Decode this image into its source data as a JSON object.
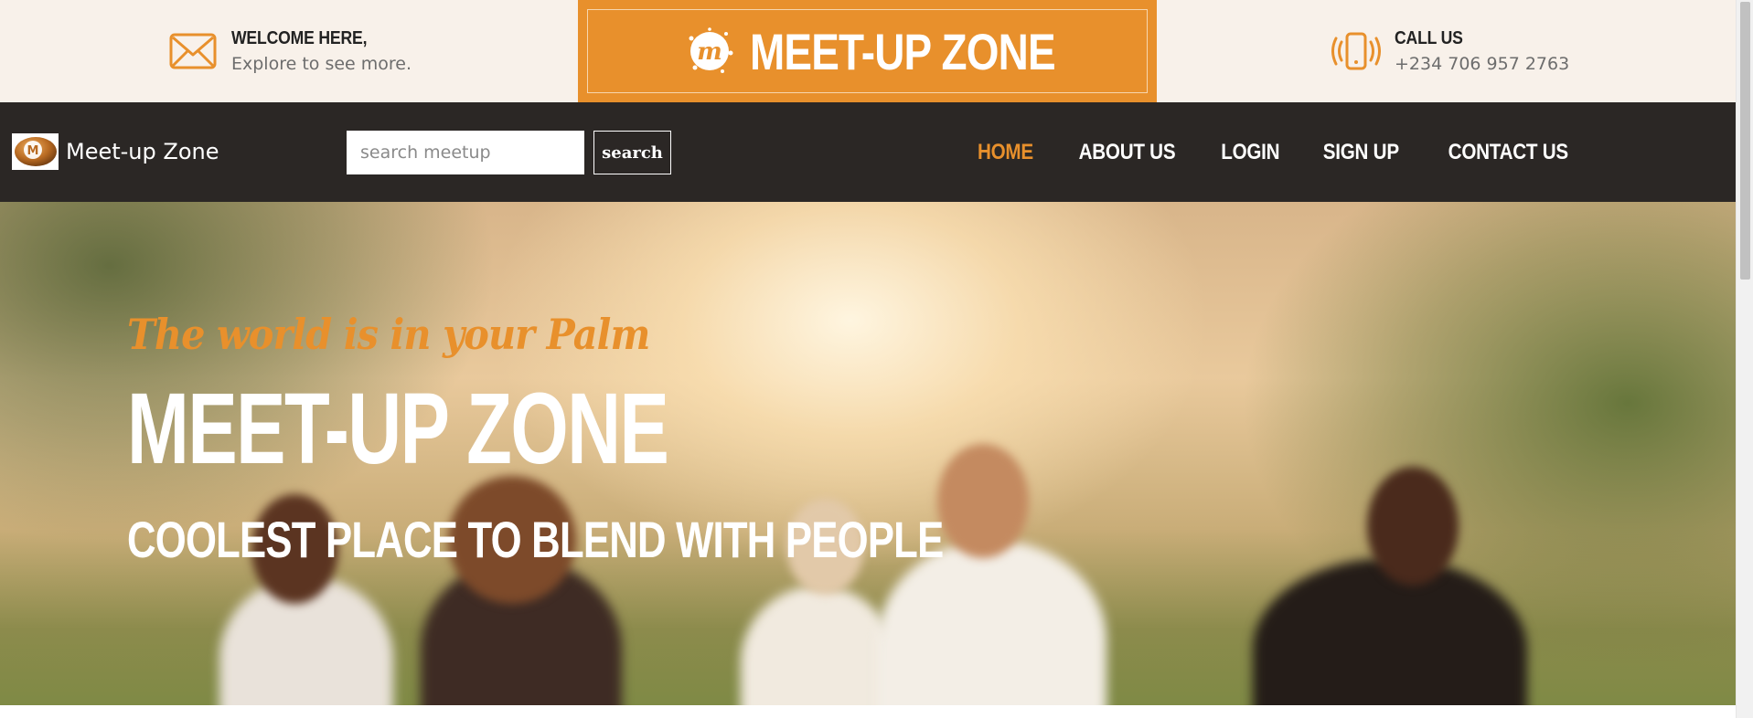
{
  "colors": {
    "accent": "#e8902c",
    "topbar_bg": "#f8f1ea",
    "navbar_bg": "#2b2725",
    "text_dark": "#222222",
    "text_muted": "#6d6d6d"
  },
  "topbar": {
    "welcome": {
      "icon": "envelope-icon",
      "title": "WELCOME HERE,",
      "subtitle": "Explore to see more."
    },
    "brand": {
      "icon": "meetup-logo-icon",
      "logo_letter": "m",
      "title": "MEET-UP ZONE"
    },
    "contact": {
      "icon": "phone-icon",
      "title": "CALL US",
      "phone": "+234 706 957 2763"
    }
  },
  "navbar": {
    "brand": {
      "logo_letter": "M",
      "label": "Meet-up Zone"
    },
    "search": {
      "placeholder": "search meetup",
      "value": "",
      "button_label": "search"
    },
    "menu": [
      {
        "label": "HOME",
        "active": true
      },
      {
        "label": "ABOUT US",
        "active": false
      },
      {
        "label": "LOGIN",
        "active": false
      },
      {
        "label": "SIGN UP",
        "active": false
      },
      {
        "label": "CONTACT US",
        "active": false
      }
    ]
  },
  "hero": {
    "tagline": "The world is in your Palm",
    "title": "MEET-UP ZONE",
    "subtitle": "COOLEST PLACE TO BLEND WITH PEOPLE"
  }
}
